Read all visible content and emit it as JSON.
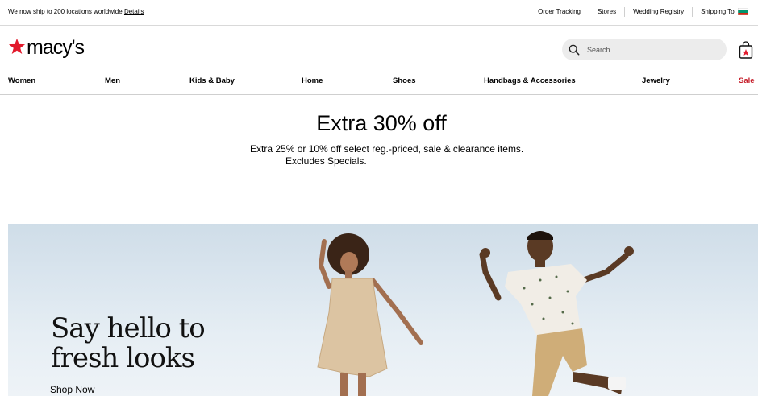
{
  "utility_bar": {
    "ship_message": "We now ship to 200 locations worldwide",
    "details_link": "Details",
    "links": [
      "Order Tracking",
      "Stores",
      "Wedding Registry",
      "Shipping To"
    ],
    "flag_icon": "bulgaria-flag-icon"
  },
  "header": {
    "logo_text": "macy's",
    "brand_color": "#e21a2c",
    "search": {
      "placeholder": "Search",
      "value": ""
    },
    "bag_icon": "shopping-bag-icon"
  },
  "nav": {
    "items": [
      {
        "label": "Women"
      },
      {
        "label": "Men"
      },
      {
        "label": "Kids & Baby"
      },
      {
        "label": "Home"
      },
      {
        "label": "Shoes"
      },
      {
        "label": "Handbags & Accessories"
      },
      {
        "label": "Jewelry"
      },
      {
        "label": "Sale"
      }
    ],
    "sale_color": "#c6202c"
  },
  "promo": {
    "title": "Extra 30% off",
    "line1": "Extra 25% or 10% off select reg.-priced, sale & clearance items.",
    "line2": "Excludes Specials."
  },
  "hero": {
    "title_line1": "Say hello to",
    "title_line2": "fresh looks",
    "cta": "Shop Now"
  }
}
